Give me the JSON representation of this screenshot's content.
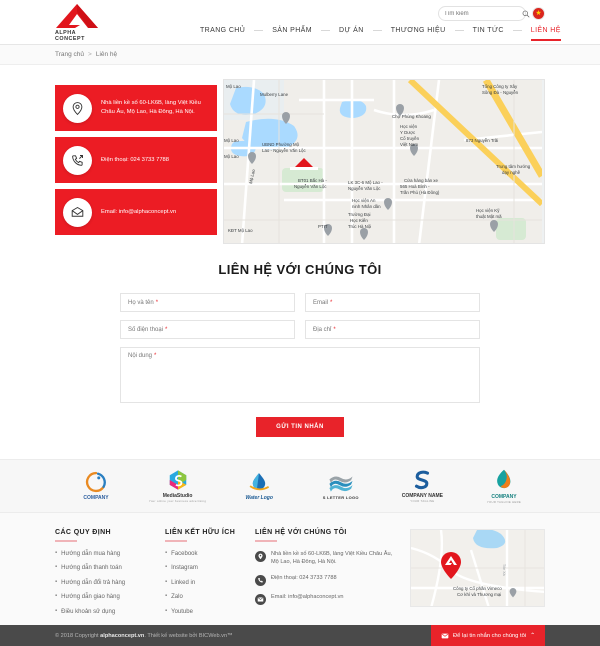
{
  "brand": {
    "logo_text": "ALPHA CONCEPT",
    "accent_color": "#e8232a",
    "card_red": "#ec1c24"
  },
  "header": {
    "nav": [
      {
        "label": "TRANG CHỦ",
        "active": false
      },
      {
        "label": "SẢN PHẨM",
        "active": false
      },
      {
        "label": "DỰ ÁN",
        "active": false
      },
      {
        "label": "THƯƠNG HIỆU",
        "active": false
      },
      {
        "label": "TIN TỨC",
        "active": false
      },
      {
        "label": "LIÊN HỆ",
        "active": true
      }
    ],
    "search_placeholder": "Tìm kiếm",
    "search_value": "",
    "search_icon": "search-icon",
    "flag_icon": "vietnam-flag-icon",
    "flag_star": "★"
  },
  "breadcrumb": {
    "home": "Trang chủ",
    "separator": ">",
    "current": "Liên hệ"
  },
  "contact_cards": [
    {
      "icon": "location-pin-icon",
      "text": "Nhà liền kề số 60-LK6B, làng Việt Kiều Châu Âu, Mộ Lao, Hà Đông, Hà Nội."
    },
    {
      "icon": "phone-outgoing-icon",
      "text": "Điện thoại: 024 3733 7788"
    },
    {
      "icon": "envelope-icon",
      "text": "Email: info@alphaconcept.vn"
    }
  ],
  "map_main": {
    "labels": [
      "Mộ Lao",
      "Mulberry Lane",
      "UBND Phường Mộ Lao - Nguyễn Văn Lộc",
      "Mộ Lao",
      "Chợ Phùng Khoang",
      "Học viện Y Dược Cổ truyền Việt Nam",
      "Tổng Công ty Xây dựng Sông Đà - Nguyễn",
      "873 Nguyễn Trãi",
      "BT01 Bắc Hà - Nguyễn Văn Lộc",
      "LK 3C-6 Mộ Lao - Nguyễn Văn Lộc",
      "Cửa hàng bán xe 565 Hoà Bình - Trần Phú (Hà Đông)",
      "Trung tâm hướng dạy nghề",
      "Học viện An ninh Nhân dân",
      "Trường Đại Học Kiến Trúc Hà Nội",
      "PTIT",
      "KĐT Mộ Lao",
      "Mộ Lao",
      "Học viện Kỹ thuật Mật mã"
    ],
    "marker_icon": "alpha-logo-map-marker"
  },
  "form": {
    "title": "LIÊN HỆ VỚI CHÚNG TÔI",
    "fields": [
      {
        "label": "Họ và tên",
        "required": "*",
        "value": ""
      },
      {
        "label": "Email",
        "required": "*",
        "value": ""
      },
      {
        "label": "Số điện thoại",
        "required": "*",
        "value": ""
      },
      {
        "label": "Địa chỉ",
        "required": "*",
        "value": ""
      },
      {
        "label": "Nội dung",
        "required": "*",
        "value": ""
      }
    ],
    "submit_label": "GỬI TIN NHẮN"
  },
  "partners": [
    {
      "name": "COMPANY",
      "tagline": "",
      "icon": "company-g-logo"
    },
    {
      "name": "MediaStudio",
      "tagline": "Your online your business advertising",
      "icon": "media-studio-logo"
    },
    {
      "name": "Water Logo",
      "tagline": "",
      "icon": "water-sail-logo"
    },
    {
      "name": "S LETTER LOGO",
      "tagline": "",
      "icon": "s-letter-wave-logo"
    },
    {
      "name": "COMPANY NAME",
      "tagline": "YOUR TAGLINE",
      "icon": "company-name-s-logo"
    },
    {
      "name": "COMPANY",
      "tagline": "YOUR TAGLINE HERE",
      "icon": "company-leaf-logo"
    }
  ],
  "footer": {
    "col1": {
      "heading": "CÁC QUY ĐỊNH",
      "links": [
        "Hướng dẫn mua hàng",
        "Hướng dẫn thanh toán",
        "Hướng dẫn đổi trả hàng",
        "Hướng dẫn giao hàng",
        "Điều khoản sử dụng"
      ]
    },
    "col2": {
      "heading": "LIÊN KẾT HỮU ÍCH",
      "links": [
        "Facebook",
        "Instagram",
        "Linked in",
        "Zalo",
        "Youtube"
      ]
    },
    "col3": {
      "heading": "LIÊN HỆ VỚI CHÚNG TÔI",
      "items": [
        {
          "icon": "location-pin-icon",
          "text": "Nhà liền kề số 60-LK6B, làng Việt Kiều Châu Âu, Mộ Lao, Hà Đông, Hà Nội."
        },
        {
          "icon": "phone-icon",
          "text": "Điện thoại: 024 3733 7788"
        },
        {
          "icon": "envelope-icon",
          "text": "Email: info@alphaconcept.vn"
        }
      ]
    },
    "map": {
      "caption_line1": "Công ty Cổ phần Vimeco",
      "caption_line2": "Cơ khí và Thương mại",
      "road_label": "Tôn Xá",
      "marker_icon": "alpha-logo-map-marker"
    }
  },
  "copyright": {
    "prefix": "© 2018 Copyright ",
    "site": "alphaconcept.vn",
    "suffix": ". Thiết kế website bởi BICWeb.vn™"
  },
  "chat_widget": {
    "icon": "message-envelope-icon",
    "label": "Để lại tin nhắn cho chúng tôi",
    "chevron": "⌃"
  }
}
